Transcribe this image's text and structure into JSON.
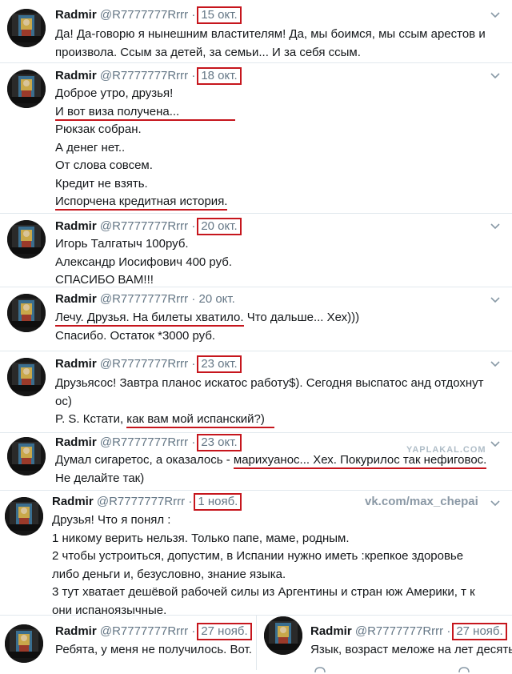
{
  "tweets": [
    {
      "name": "Radmir",
      "handle": "@R7777777Rrrr",
      "date": "15 окт.",
      "lines": [
        "Да! Да-говорю я нынешним властителям! Да, мы боимся, мы ссым арестов и",
        "произвола. Ссым за детей, за семьи... И за себя ссым."
      ]
    },
    {
      "name": "Radmir",
      "handle": "@R7777777Rrrr",
      "date": "18 окт.",
      "lines": [
        "Доброе утро, друзья!",
        "И вот виза получена...",
        "Рюкзак собран.",
        "А денег нет..",
        "От слова совсем.",
        "Кредит не взять.",
        "Испорчена кредитная история."
      ]
    },
    {
      "name": "Radmir",
      "handle": "@R7777777Rrrr",
      "date": "20 окт.",
      "lines": [
        "Игорь Талгатыч 100руб.",
        "Александр Иосифович 400 руб.",
        "СПАСИБО ВАМ!!!"
      ]
    },
    {
      "name": "Radmir",
      "handle": "@R7777777Rrrr",
      "date": "20 окт.",
      "line1_underlined": "Лечу. Друзья. На билеты хватило.",
      "line1_rest": " Что дальше... Хех)))",
      "line2": "Спасибо. Остаток *3000 руб."
    },
    {
      "name": "Radmir",
      "handle": "@R7777777Rrrr",
      "date": "23 окт.",
      "line1": "Друзьясос! Завтра планос искатос работу$). Сегодня выспатос анд отдохнут",
      "line2": "ос)",
      "line3_start": "P. S. Кстати, ",
      "line3_underlined": "как вам мой испанский?)"
    },
    {
      "name": "Radmir",
      "handle": "@R7777777Rrrr",
      "date": "23 окт.",
      "line1_start": "Думал сигаретос, а оказалось - ",
      "line1_underlined": "марихуанос... Хех. Покурилос так нефиговос.",
      "line2": "Не делайте так)"
    },
    {
      "name": "Radmir",
      "handle": "@R7777777Rrrr",
      "date": "1 нояб.",
      "lines": [
        "Друзья! Что я понял :",
        "1 никому верить нельзя.  Только папе, маме, родным.",
        "2 чтобы устроиться, допустим, в Испании нужно иметь :крепкое здоровье",
        "либо деньги и, безусловно, знание языка.",
        "3 тут хватает дешёвой рабочей силы из Аргентины и стран юж Америки, т к",
        "они испаноязычные."
      ]
    },
    {
      "name": "Radmir",
      "handle": "@R7777777Rrrr",
      "date": "27 нояб.",
      "lines": [
        "Ребята, у меня не получилось. Вот."
      ]
    },
    {
      "name": "Radmir",
      "handle": "@R7777777Rrrr",
      "date": "27 нояб.",
      "lines": [
        "Язык, возраст меложе на лет десять"
      ]
    }
  ],
  "watermark": "vk.com/max_chepai",
  "watermark2": "YAPLAKAL.COM"
}
